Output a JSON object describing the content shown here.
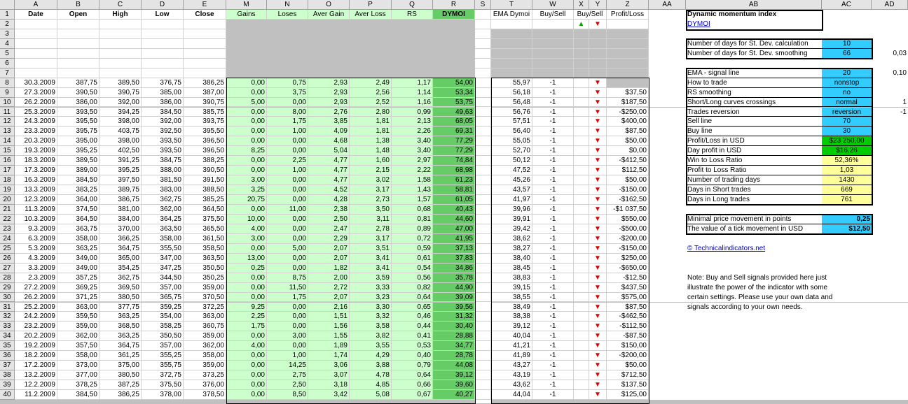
{
  "columns": [
    "A",
    "B",
    "C",
    "D",
    "E",
    "M",
    "N",
    "O",
    "P",
    "Q",
    "R",
    "S",
    "T",
    "W",
    "X",
    "Y",
    "Z",
    "AA",
    "AB",
    "AC",
    "AD"
  ],
  "col_header_row": {
    "date": "Date",
    "open": "Open",
    "high": "High",
    "low": "Low",
    "close": "Close",
    "gains": "Gains",
    "loses": "Loses",
    "aver_gain": "Aver Gain",
    "aver_loss": "Aver Loss",
    "rs": "RS",
    "dymoi": "DYMOI",
    "ema": "EMA Dymoi",
    "buysell": "Buy/Sell",
    "buysell2": "Buy/Sell",
    "profitloss": "Profit/Loss"
  },
  "arrows": {
    "up": "▲",
    "down": "▼"
  },
  "rows": [
    {
      "n": "8",
      "date": "30.3.2009",
      "open": "387,75",
      "high": "389,50",
      "low": "376,75",
      "close": "386,25",
      "gains": "0,00",
      "loses": "0,75",
      "ag": "2,93",
      "al": "2,49",
      "rs": "1,17",
      "dy": "54,00",
      "ema": "55,97",
      "w": "-1",
      "pl": ""
    },
    {
      "n": "9",
      "date": "27.3.2009",
      "open": "390,50",
      "high": "390,75",
      "low": "385,00",
      "close": "387,00",
      "gains": "0,00",
      "loses": "3,75",
      "ag": "2,93",
      "al": "2,56",
      "rs": "1,14",
      "dy": "53,34",
      "ema": "56,18",
      "w": "-1",
      "pl": "$37,50"
    },
    {
      "n": "10",
      "date": "26.2.2009",
      "open": "386,00",
      "high": "392,00",
      "low": "386,00",
      "close": "390,75",
      "gains": "5,00",
      "loses": "0,00",
      "ag": "2,93",
      "al": "2,52",
      "rs": "1,16",
      "dy": "53,75",
      "ema": "56,48",
      "w": "-1",
      "pl": "$187,50"
    },
    {
      "n": "11",
      "date": "25.3.2009",
      "open": "393,50",
      "high": "394,25",
      "low": "384,50",
      "close": "385,75",
      "gains": "0,00",
      "loses": "8,00",
      "ag": "2,76",
      "al": "2,80",
      "rs": "0,99",
      "dy": "49,63",
      "ema": "56,76",
      "w": "-1",
      "pl": "-$250,00"
    },
    {
      "n": "12",
      "date": "24.3.2009",
      "open": "395,50",
      "high": "398,00",
      "low": "392,00",
      "close": "393,75",
      "gains": "0,00",
      "loses": "1,75",
      "ag": "3,85",
      "al": "1,81",
      "rs": "2,13",
      "dy": "68,05",
      "ema": "57,51",
      "w": "-1",
      "pl": "$400,00"
    },
    {
      "n": "13",
      "date": "23.3.2009",
      "open": "395,75",
      "high": "403,75",
      "low": "392,50",
      "close": "395,50",
      "gains": "0,00",
      "loses": "1,00",
      "ag": "4,09",
      "al": "1,81",
      "rs": "2,26",
      "dy": "69,31",
      "ema": "56,40",
      "w": "-1",
      "pl": "$87,50"
    },
    {
      "n": "14",
      "date": "20.3.2009",
      "open": "395,00",
      "high": "398,00",
      "low": "393,50",
      "close": "396,50",
      "gains": "0,00",
      "loses": "0,00",
      "ag": "4,68",
      "al": "1,38",
      "rs": "3,40",
      "dy": "77,29",
      "ema": "55,05",
      "w": "-1",
      "pl": "$50,00"
    },
    {
      "n": "15",
      "date": "19.3.2009",
      "open": "395,25",
      "high": "402,50",
      "low": "393,50",
      "close": "396,50",
      "gains": "8,25",
      "loses": "0,00",
      "ag": "5,04",
      "al": "1,48",
      "rs": "3,40",
      "dy": "77,29",
      "ema": "52,70",
      "w": "-1",
      "pl": "$0,00"
    },
    {
      "n": "16",
      "date": "18.3.2009",
      "open": "389,50",
      "high": "391,25",
      "low": "384,75",
      "close": "388,25",
      "gains": "0,00",
      "loses": "2,25",
      "ag": "4,77",
      "al": "1,60",
      "rs": "2,97",
      "dy": "74,84",
      "ema": "50,12",
      "w": "-1",
      "pl": "-$412,50"
    },
    {
      "n": "17",
      "date": "17.3.2009",
      "open": "389,00",
      "high": "395,25",
      "low": "388,00",
      "close": "390,50",
      "gains": "0,00",
      "loses": "1,00",
      "ag": "4,77",
      "al": "2,15",
      "rs": "2,22",
      "dy": "68,98",
      "ema": "47,52",
      "w": "-1",
      "pl": "$112,50"
    },
    {
      "n": "18",
      "date": "16.3.2009",
      "open": "384,50",
      "high": "397,50",
      "low": "381,50",
      "close": "391,50",
      "gains": "3,00",
      "loses": "0,00",
      "ag": "4,77",
      "al": "3,02",
      "rs": "1,58",
      "dy": "61,23",
      "ema": "45,26",
      "w": "-1",
      "pl": "$50,00"
    },
    {
      "n": "19",
      "date": "13.3.2009",
      "open": "383,25",
      "high": "389,75",
      "low": "383,00",
      "close": "388,50",
      "gains": "3,25",
      "loses": "0,00",
      "ag": "4,52",
      "al": "3,17",
      "rs": "1,43",
      "dy": "58,81",
      "ema": "43,57",
      "w": "-1",
      "pl": "-$150,00"
    },
    {
      "n": "20",
      "date": "12.3.2009",
      "open": "364,00",
      "high": "386,75",
      "low": "362,75",
      "close": "385,25",
      "gains": "20,75",
      "loses": "0,00",
      "ag": "4,28",
      "al": "2,73",
      "rs": "1,57",
      "dy": "61,05",
      "ema": "41,97",
      "w": "-1",
      "pl": "-$162,50"
    },
    {
      "n": "21",
      "date": "11.3.2009",
      "open": "374,50",
      "high": "381,00",
      "low": "362,00",
      "close": "364,50",
      "gains": "0,00",
      "loses": "11,00",
      "ag": "2,38",
      "al": "3,50",
      "rs": "0,68",
      "dy": "40,43",
      "ema": "39,96",
      "w": "-1",
      "pl": "-$1 037,50"
    },
    {
      "n": "22",
      "date": "10.3.2009",
      "open": "364,50",
      "high": "384,00",
      "low": "364,25",
      "close": "375,50",
      "gains": "10,00",
      "loses": "0,00",
      "ag": "2,50",
      "al": "3,11",
      "rs": "0,81",
      "dy": "44,60",
      "ema": "39,91",
      "w": "-1",
      "pl": "$550,00"
    },
    {
      "n": "23",
      "date": "9.3.2009",
      "open": "363,75",
      "high": "370,00",
      "low": "363,50",
      "close": "365,50",
      "gains": "4,00",
      "loses": "0,00",
      "ag": "2,47",
      "al": "2,78",
      "rs": "0,89",
      "dy": "47,00",
      "ema": "39,42",
      "w": "-1",
      "pl": "-$500,00"
    },
    {
      "n": "24",
      "date": "6.3.2009",
      "open": "358,00",
      "high": "366,25",
      "low": "358,00",
      "close": "361,50",
      "gains": "3,00",
      "loses": "0,00",
      "ag": "2,29",
      "al": "3,17",
      "rs": "0,72",
      "dy": "41,95",
      "ema": "38,62",
      "w": "-1",
      "pl": "-$200,00"
    },
    {
      "n": "25",
      "date": "5.3.2009",
      "open": "363,25",
      "high": "364,75",
      "low": "355,50",
      "close": "358,50",
      "gains": "0,00",
      "loses": "5,00",
      "ag": "2,07",
      "al": "3,51",
      "rs": "0,59",
      "dy": "37,13",
      "ema": "38,27",
      "w": "-1",
      "pl": "-$150,00"
    },
    {
      "n": "26",
      "date": "4.3.2009",
      "open": "349,00",
      "high": "365,00",
      "low": "347,00",
      "close": "363,50",
      "gains": "13,00",
      "loses": "0,00",
      "ag": "2,07",
      "al": "3,41",
      "rs": "0,61",
      "dy": "37,83",
      "ema": "38,40",
      "w": "-1",
      "pl": "$250,00"
    },
    {
      "n": "27",
      "date": "3.3.2009",
      "open": "349,00",
      "high": "354,25",
      "low": "347,25",
      "close": "350,50",
      "gains": "0,25",
      "loses": "0,00",
      "ag": "1,82",
      "al": "3,41",
      "rs": "0,54",
      "dy": "34,86",
      "ema": "38,45",
      "w": "-1",
      "pl": "-$650,00"
    },
    {
      "n": "28",
      "date": "2.3.2009",
      "open": "357,25",
      "high": "362,75",
      "low": "344,50",
      "close": "350,25",
      "gains": "0,00",
      "loses": "8,75",
      "ag": "2,00",
      "al": "3,59",
      "rs": "0,56",
      "dy": "35,78",
      "ema": "38,83",
      "w": "-1",
      "pl": "-$12,50"
    },
    {
      "n": "29",
      "date": "27.2.2009",
      "open": "369,25",
      "high": "369,50",
      "low": "357,00",
      "close": "359,00",
      "gains": "0,00",
      "loses": "11,50",
      "ag": "2,72",
      "al": "3,33",
      "rs": "0,82",
      "dy": "44,90",
      "ema": "39,15",
      "w": "-1",
      "pl": "$437,50"
    },
    {
      "n": "30",
      "date": "26.2.2009",
      "open": "371,25",
      "high": "380,50",
      "low": "365,75",
      "close": "370,50",
      "gains": "0,00",
      "loses": "1,75",
      "ag": "2,07",
      "al": "3,23",
      "rs": "0,64",
      "dy": "39,09",
      "ema": "38,55",
      "w": "-1",
      "pl": "$575,00"
    },
    {
      "n": "31",
      "date": "25.2.2009",
      "open": "363,00",
      "high": "377,75",
      "low": "359,25",
      "close": "372,25",
      "gains": "9,25",
      "loses": "0,00",
      "ag": "2,16",
      "al": "3,30",
      "rs": "0,65",
      "dy": "39,56",
      "ema": "38,49",
      "w": "-1",
      "pl": "$87,50"
    },
    {
      "n": "32",
      "date": "24.2.2009",
      "open": "359,50",
      "high": "363,25",
      "low": "354,00",
      "close": "363,00",
      "gains": "2,25",
      "loses": "0,00",
      "ag": "1,51",
      "al": "3,32",
      "rs": "0,46",
      "dy": "31,32",
      "ema": "38,38",
      "w": "-1",
      "pl": "-$462,50"
    },
    {
      "n": "33",
      "date": "23.2.2009",
      "open": "359,00",
      "high": "368,50",
      "low": "358,25",
      "close": "360,75",
      "gains": "1,75",
      "loses": "0,00",
      "ag": "1,56",
      "al": "3,58",
      "rs": "0,44",
      "dy": "30,40",
      "ema": "39,12",
      "w": "-1",
      "pl": "-$112,50"
    },
    {
      "n": "34",
      "date": "20.2.2009",
      "open": "362,00",
      "high": "363,25",
      "low": "350,50",
      "close": "359,00",
      "gains": "0,00",
      "loses": "3,00",
      "ag": "1,55",
      "al": "3,82",
      "rs": "0,41",
      "dy": "28,88",
      "ema": "40,04",
      "w": "-1",
      "pl": "-$87,50"
    },
    {
      "n": "35",
      "date": "19.2.2009",
      "open": "357,50",
      "high": "364,75",
      "low": "357,00",
      "close": "362,00",
      "gains": "4,00",
      "loses": "0,00",
      "ag": "1,89",
      "al": "3,55",
      "rs": "0,53",
      "dy": "34,77",
      "ema": "41,21",
      "w": "-1",
      "pl": "$150,00"
    },
    {
      "n": "36",
      "date": "18.2.2009",
      "open": "358,00",
      "high": "361,25",
      "low": "355,25",
      "close": "358,00",
      "gains": "0,00",
      "loses": "1,00",
      "ag": "1,74",
      "al": "4,29",
      "rs": "0,40",
      "dy": "28,78",
      "ema": "41,89",
      "w": "-1",
      "pl": "-$200,00"
    },
    {
      "n": "37",
      "date": "17.2.2009",
      "open": "373,00",
      "high": "375,00",
      "low": "355,75",
      "close": "359,00",
      "gains": "0,00",
      "loses": "14,25",
      "ag": "3,06",
      "al": "3,88",
      "rs": "0,79",
      "dy": "44,08",
      "ema": "43,27",
      "w": "-1",
      "pl": "$50,00"
    },
    {
      "n": "38",
      "date": "13.2.2009",
      "open": "377,00",
      "high": "380,50",
      "low": "372,75",
      "close": "373,25",
      "gains": "0,00",
      "loses": "2,75",
      "ag": "3,07",
      "al": "4,78",
      "rs": "0,64",
      "dy": "39,12",
      "ema": "43,19",
      "w": "-1",
      "pl": "$712,50"
    },
    {
      "n": "39",
      "date": "12.2.2009",
      "open": "378,25",
      "high": "387,25",
      "low": "375,50",
      "close": "376,00",
      "gains": "0,00",
      "loses": "2,50",
      "ag": "3,18",
      "al": "4,85",
      "rs": "0,66",
      "dy": "39,60",
      "ema": "43,62",
      "w": "-1",
      "pl": "$137,50"
    },
    {
      "n": "40",
      "date": "11.2.2009",
      "open": "384,50",
      "high": "386,25",
      "low": "378,00",
      "close": "378,50",
      "gains": "0,00",
      "loses": "8,50",
      "ag": "3,42",
      "al": "5,08",
      "rs": "0,67",
      "dy": "40,27",
      "ema": "44,04",
      "w": "-1",
      "pl": "$125,00"
    }
  ],
  "panel": {
    "title": "Dynamic momentum index",
    "link": "DYMOI",
    "stdev": [
      {
        "label": "Number of days for St. Dev. calculation",
        "value": "10"
      },
      {
        "label": "Number of days for St. Dev. smoothing",
        "value": "66",
        "extra": "0,03"
      }
    ],
    "params": [
      {
        "label": "EMA - signal line",
        "value": "20",
        "style": "cy",
        "extra": "0,10"
      },
      {
        "label": "How to trade",
        "value": "nonstop",
        "style": "cy"
      },
      {
        "label": "RS smoothing",
        "value": "no",
        "style": "cy"
      },
      {
        "label": "Short/Long curves crossings",
        "value": "normal",
        "style": "cy",
        "extra": "1"
      },
      {
        "label": "Trades reversion",
        "value": "reversion",
        "style": "cy",
        "extra": "-1"
      },
      {
        "label": "Sell line",
        "value": "70",
        "style": "cy"
      },
      {
        "label": "Buy line",
        "value": "30",
        "style": "cy"
      },
      {
        "label": "Profit/Loss in USD",
        "value": "$23 250,00",
        "style": "bg"
      },
      {
        "label": "Day profit in USD",
        "value": "$16,26",
        "style": "bg"
      },
      {
        "label": "Win to Loss Ratio",
        "value": "52,36%",
        "style": "yl"
      },
      {
        "label": "Profit to Loss Ratio",
        "value": "1,03",
        "style": "yl"
      },
      {
        "label": "Number of trading days",
        "value": "1430",
        "style": "yl"
      },
      {
        "label": "Days in Short trades",
        "value": "669",
        "style": "yl"
      },
      {
        "label": "Days in Long trades",
        "value": "761",
        "style": "yl"
      }
    ],
    "tick": [
      {
        "label": "Minimal price movement in points",
        "value": "0,25"
      },
      {
        "label": "The value of a tick movement in USD",
        "value": "$12,50"
      }
    ],
    "site": "© Technicalindicators.net",
    "note": [
      "Note: Buy and Sell signals provided here just",
      "illustrate the power of the indicator with some",
      "certain settings. Please use your own data and",
      "signals according to your own needs."
    ]
  }
}
